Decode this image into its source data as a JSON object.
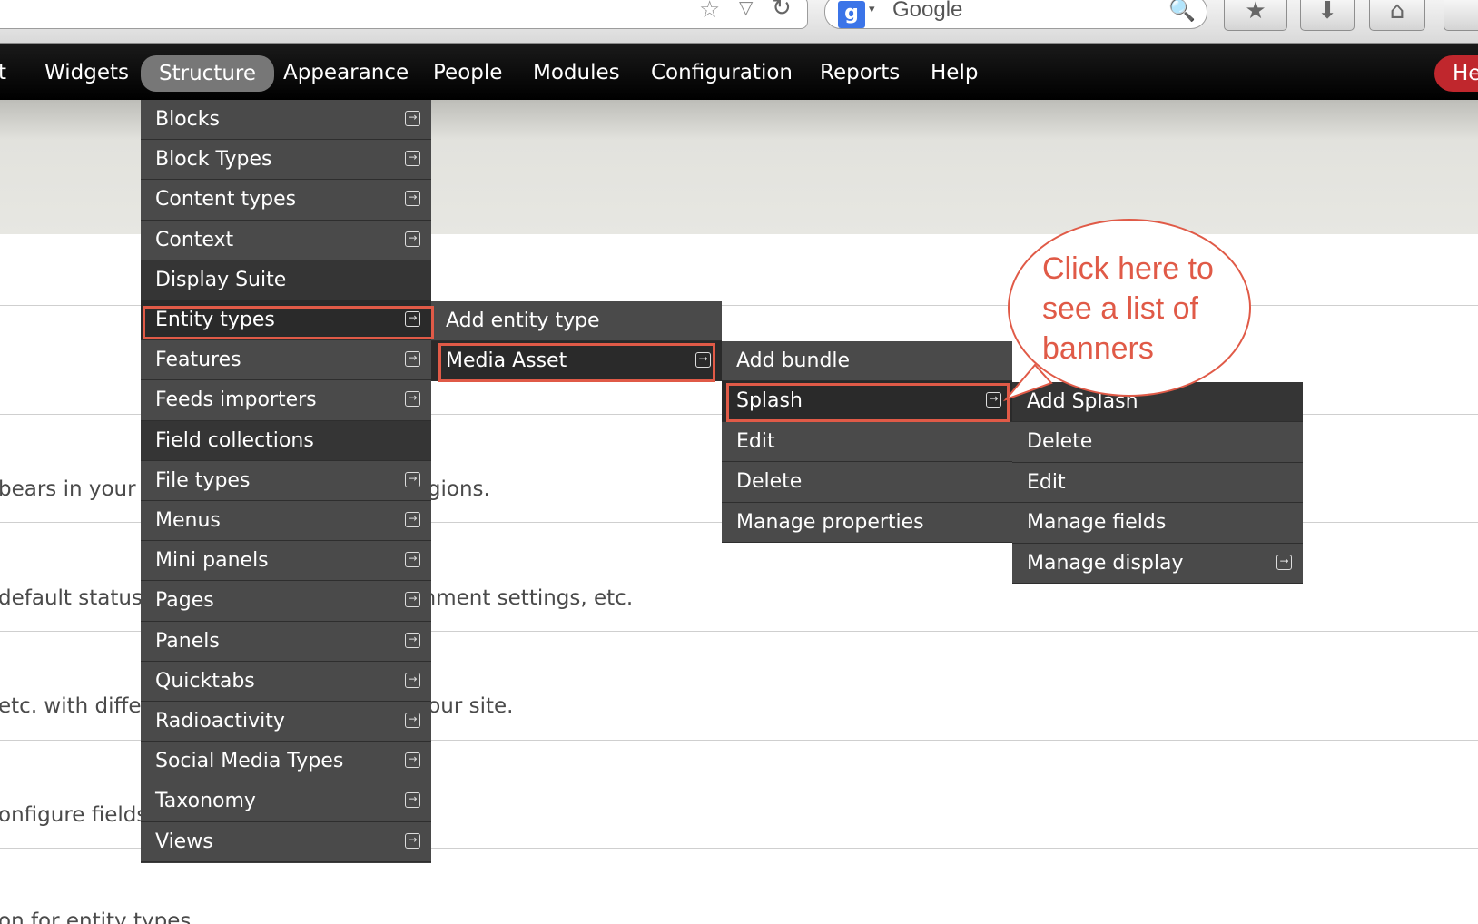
{
  "browser": {
    "search_placeholder": "Google",
    "star_icon": "☆",
    "dropdown_icon": "▽",
    "reload_icon": "↻",
    "google_icon_letter": "g",
    "search_engine_arrow": "▾",
    "magnifier_icon": "🔍",
    "bookmarks_icon": "★",
    "download_icon": "⬇",
    "home_icon": "⌂"
  },
  "toolbar": {
    "items": [
      "t",
      "Widgets",
      "Structure",
      "Appearance",
      "People",
      "Modules",
      "Configuration",
      "Reports",
      "Help"
    ],
    "hello": "He"
  },
  "page": {
    "lines": [
      "bears in your site's sidebars and other regions.",
      "default status, front page promotion, comment settings, etc.",
      "etc. with different contexts to structure your site.",
      "onfigure fields, view modes etc.",
      "on for entity types."
    ]
  },
  "menus": {
    "structure": [
      {
        "label": "Blocks",
        "sub": true
      },
      {
        "label": "Block Types",
        "sub": true
      },
      {
        "label": "Content types",
        "sub": true
      },
      {
        "label": "Context",
        "sub": true
      },
      {
        "label": "Display Suite",
        "sub": false
      },
      {
        "label": "Entity types",
        "sub": true
      },
      {
        "label": "Features",
        "sub": true
      },
      {
        "label": "Feeds importers",
        "sub": true
      },
      {
        "label": "Field collections",
        "sub": false
      },
      {
        "label": "File types",
        "sub": true
      },
      {
        "label": "Menus",
        "sub": true
      },
      {
        "label": "Mini panels",
        "sub": true
      },
      {
        "label": "Pages",
        "sub": true
      },
      {
        "label": "Panels",
        "sub": true
      },
      {
        "label": "Quicktabs",
        "sub": true
      },
      {
        "label": "Radioactivity",
        "sub": true
      },
      {
        "label": "Social Media Types",
        "sub": true
      },
      {
        "label": "Taxonomy",
        "sub": true
      },
      {
        "label": "Views",
        "sub": true
      }
    ],
    "entity_types": [
      {
        "label": "Add entity type",
        "sub": false
      },
      {
        "label": "Media Asset",
        "sub": true
      }
    ],
    "media_asset": [
      {
        "label": "Add bundle",
        "sub": false
      },
      {
        "label": "Splash",
        "sub": true
      },
      {
        "label": "Edit",
        "sub": false
      },
      {
        "label": "Delete",
        "sub": false
      },
      {
        "label": "Manage properties",
        "sub": false
      }
    ],
    "splash": [
      {
        "label": "Add Splash",
        "sub": false
      },
      {
        "label": "Delete",
        "sub": false
      },
      {
        "label": "Edit",
        "sub": false
      },
      {
        "label": "Manage fields",
        "sub": false
      },
      {
        "label": "Manage display",
        "sub": true
      }
    ],
    "submenu_icon": "→"
  },
  "callout": {
    "text": "Click here to see a list of banners",
    "color": "#e05a47"
  }
}
